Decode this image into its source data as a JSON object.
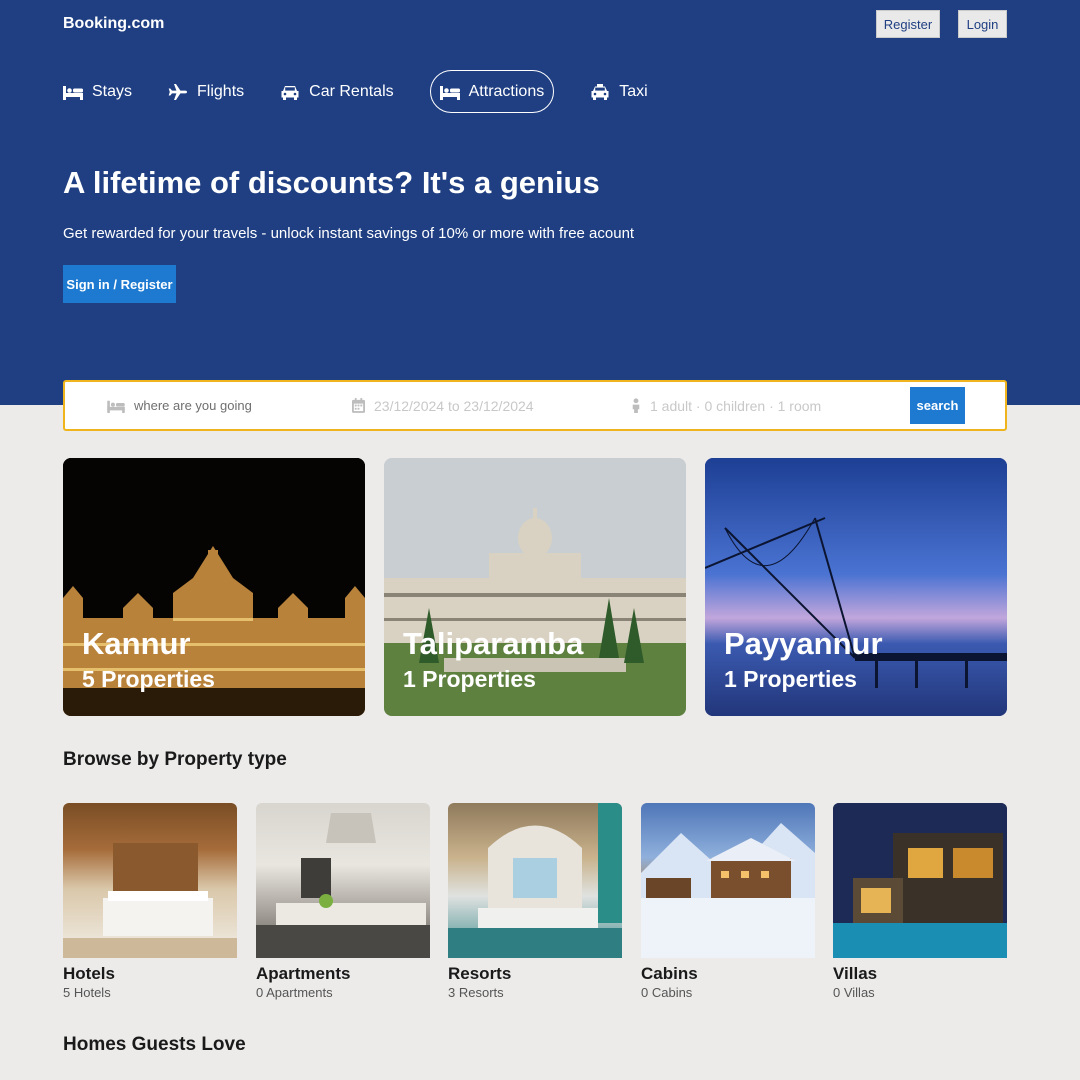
{
  "header": {
    "logo": "Booking.com",
    "register_label": "Register",
    "login_label": "Login"
  },
  "nav": [
    {
      "label": "Stays",
      "icon": "bed-icon",
      "active": false
    },
    {
      "label": "Flights",
      "icon": "plane-icon",
      "active": false
    },
    {
      "label": "Car Rentals",
      "icon": "car-icon",
      "active": false
    },
    {
      "label": "Attractions",
      "icon": "bed-icon",
      "active": true
    },
    {
      "label": "Taxi",
      "icon": "taxi-icon",
      "active": false
    }
  ],
  "hero": {
    "title": "A lifetime of discounts? It's a genius",
    "subtitle": "Get rewarded for your travels - unlock instant savings of 10% or more with free acount",
    "cta_label": "Sign in / Register"
  },
  "search": {
    "destination_placeholder": "where are you going",
    "dates": "23/12/2024 to 23/12/2024",
    "options": "1 adult · 0 children · 1 room",
    "button_label": "search"
  },
  "featured": [
    {
      "city": "Kannur",
      "count": "5 Properties"
    },
    {
      "city": "Taliparamba",
      "count": "1 Properties"
    },
    {
      "city": "Payyannur",
      "count": "1 Properties"
    }
  ],
  "property_types_title": "Browse by Property type",
  "property_types": [
    {
      "name": "Hotels",
      "count": "5 Hotels"
    },
    {
      "name": "Apartments",
      "count": "0 Apartments"
    },
    {
      "name": "Resorts",
      "count": "3 Resorts"
    },
    {
      "name": "Cabins",
      "count": "0 Cabins"
    },
    {
      "name": "Villas",
      "count": "0 Villas"
    }
  ],
  "homes_title": "Homes Guests Love",
  "colors": {
    "brand_blue": "#1f3f82",
    "accent_blue": "#1e7ad1",
    "search_border": "#f0b51c",
    "background": "#ecebea"
  }
}
